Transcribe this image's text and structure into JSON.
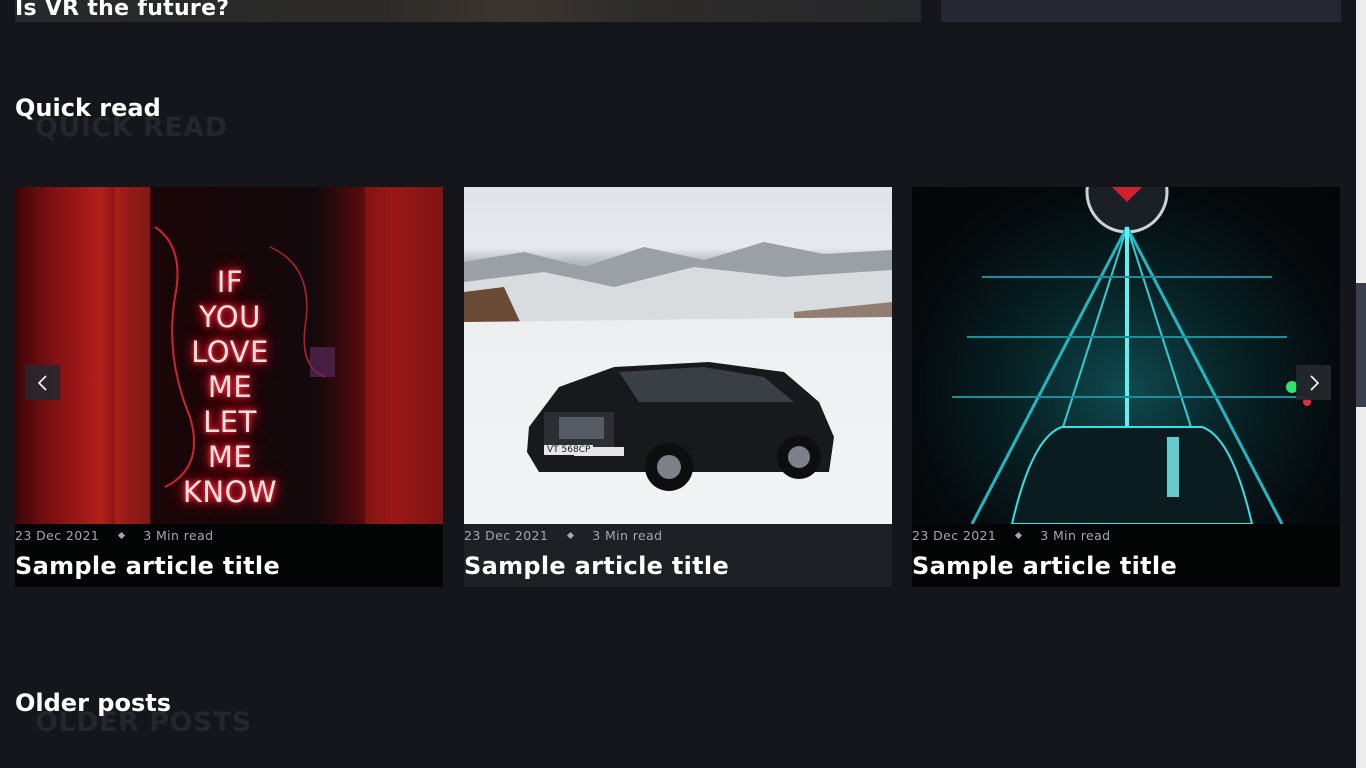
{
  "top_cards": {
    "left_title": "Is VR the future?"
  },
  "sections": {
    "quick_read": {
      "heading": "Quick read",
      "shadow": "QUICK READ"
    },
    "older_posts": {
      "heading": "Older posts",
      "shadow": "OLDER POSTS"
    }
  },
  "carousel": {
    "cards": [
      {
        "image": "neon-sign",
        "neon_lines": "IF YOU LOVE ME LET ME KNOW",
        "date": "23 Dec 2021",
        "read_time": "3 Min read",
        "title": "Sample article title"
      },
      {
        "image": "car-in-snow",
        "plate": "VT 568CP",
        "date": "23 Dec 2021",
        "read_time": "3 Min read",
        "title": "Sample article title"
      },
      {
        "image": "teal-neon-structure",
        "date": "23 Dec 2021",
        "read_time": "3 Min read",
        "title": "Sample article title"
      }
    ],
    "prev_icon": "chevron-left-icon",
    "next_icon": "chevron-right-icon"
  }
}
